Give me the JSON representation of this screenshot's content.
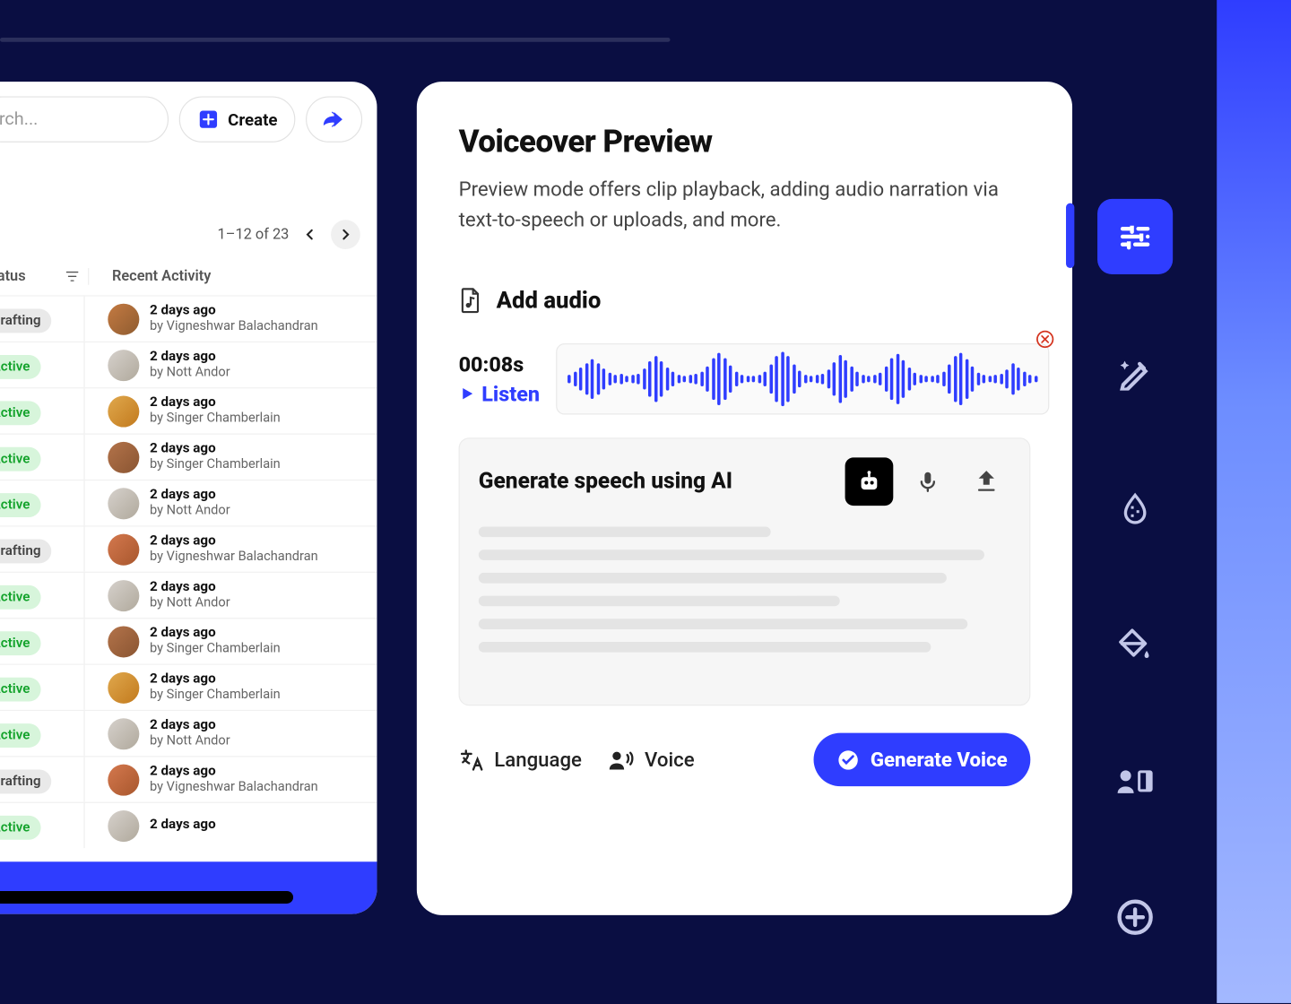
{
  "leftPanel": {
    "searchPlaceholder": "rch...",
    "createLabel": "Create",
    "pager": "1–12 of 23",
    "columns": {
      "status": "Status",
      "activity": "Recent Activity"
    },
    "rows": [
      {
        "status": "Drafting",
        "statusClass": "s-drafting",
        "time": "2 days ago",
        "by": "by Vigneshwar Balachandran",
        "avatar": "c1"
      },
      {
        "status": "Active",
        "statusClass": "s-active",
        "time": "2 days ago",
        "by": "by Nott Andor",
        "avatar": "c2"
      },
      {
        "status": "Active",
        "statusClass": "s-active",
        "time": "2 days ago",
        "by": "by Singer Chamberlain",
        "avatar": "c3"
      },
      {
        "status": "Active",
        "statusClass": "s-active",
        "time": "2 days ago",
        "by": "by Singer Chamberlain",
        "avatar": "c4"
      },
      {
        "status": "Active",
        "statusClass": "s-active",
        "time": "2 days ago",
        "by": "by Nott Andor",
        "avatar": "c2"
      },
      {
        "status": "Drafting",
        "statusClass": "s-drafting",
        "time": "2 days ago",
        "by": "by Vigneshwar Balachandran",
        "avatar": "c5"
      },
      {
        "status": "Active",
        "statusClass": "s-active",
        "time": "2 days ago",
        "by": "by Nott Andor",
        "avatar": "c2"
      },
      {
        "status": "Active",
        "statusClass": "s-active",
        "time": "2 days ago",
        "by": "by Singer Chamberlain",
        "avatar": "c4"
      },
      {
        "status": "Active",
        "statusClass": "s-active",
        "time": "2 days ago",
        "by": "by Singer Chamberlain",
        "avatar": "c3"
      },
      {
        "status": "Active",
        "statusClass": "s-active",
        "time": "2 days ago",
        "by": "by Nott Andor",
        "avatar": "c2"
      },
      {
        "status": "Drafting",
        "statusClass": "s-drafting",
        "time": "2 days ago",
        "by": "by Vigneshwar Balachandran",
        "avatar": "c5"
      },
      {
        "status": "Active",
        "statusClass": "s-active",
        "time": "2 days ago",
        "by": "",
        "avatar": "c2"
      }
    ]
  },
  "voiceover": {
    "title": "Voiceover Preview",
    "description": "Preview mode offers clip playback, adding audio narration via text-to-speech or uploads, and more.",
    "addAudio": "Add audio",
    "duration": "00:08s",
    "listen": "Listen",
    "generateTitle": "Generate speech using AI",
    "language": "Language",
    "voice": "Voice",
    "generateVoice": "Generate Voice"
  }
}
